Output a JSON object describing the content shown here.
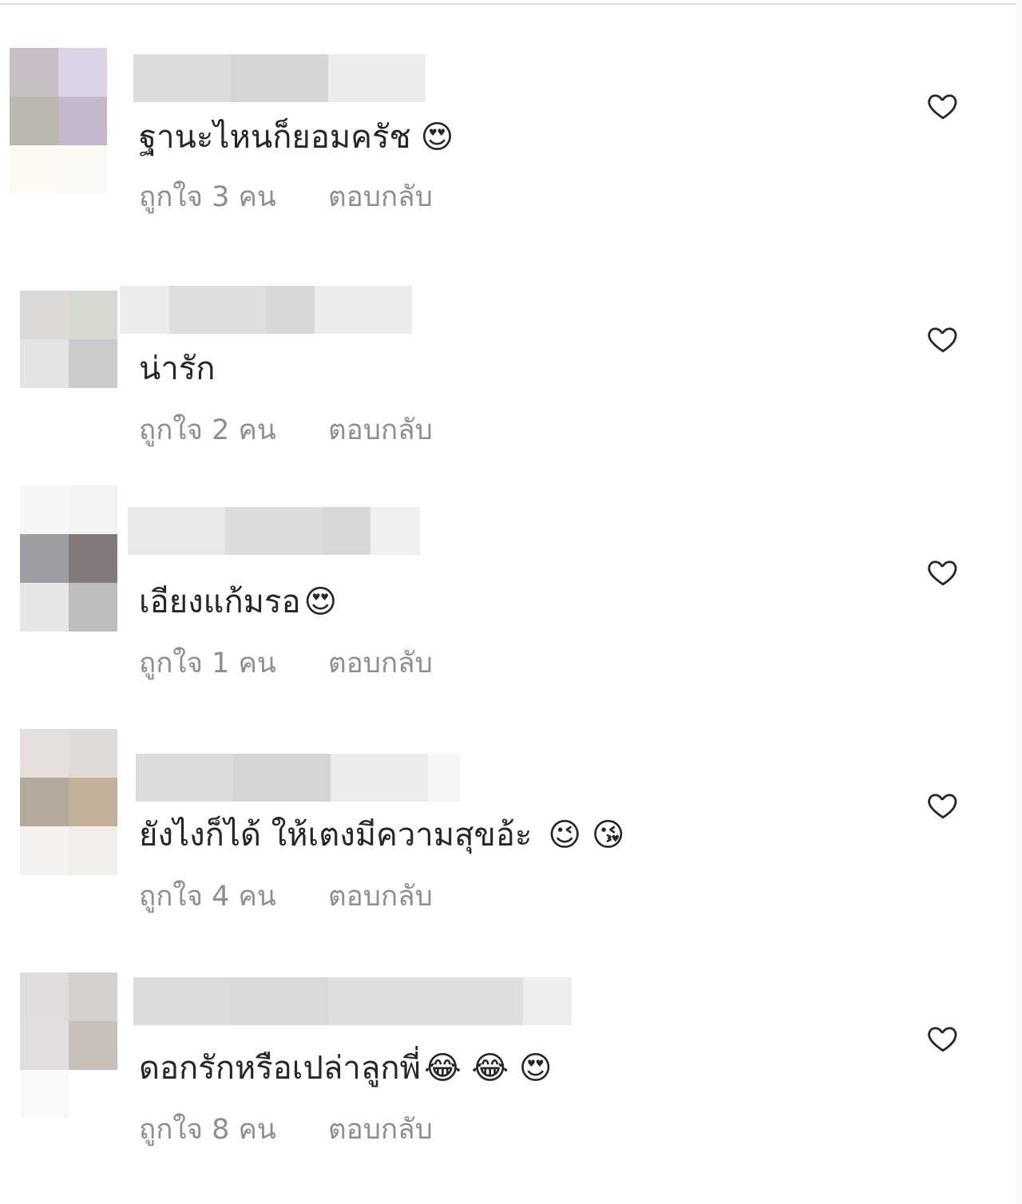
{
  "comments": [
    {
      "text": "ฐานะไหนก็ยอมครัช",
      "emoji": "😍",
      "likes": "ถูกใจ 3 คน",
      "reply": "ตอบกลับ",
      "avatar_colors": [
        "#c8bfc6",
        "#dcd3e6",
        "#bab8ae",
        "#c5b8cc",
        "#fdfaf3",
        "#fbf9f5"
      ],
      "name_colors": [
        "#dcdcdc",
        "#d6d6d6",
        "#ececec"
      ]
    },
    {
      "text": "น่ารัก",
      "emoji": "",
      "likes": "ถูกใจ 2 คน",
      "reply": "ตอบกลับ",
      "avatar_colors": [
        "#dcd9d6",
        "#d5d9d0",
        "#e4e4e4",
        "#cbcacc",
        "#ffffff",
        "#ffffff"
      ],
      "name_colors": [
        "#ececec",
        "#dedede",
        "#d7d7d7",
        "#ececec"
      ]
    },
    {
      "text": "เอียงแก้มรอ",
      "emoji": "😍",
      "likes": "ถูกใจ 1 คน",
      "reply": "ตอบกลับ",
      "avatar_colors": [
        "#f6f6f6",
        "#f3f3f3",
        "#9e9da4",
        "#827a7b",
        "#e6e6e6",
        "#bfbcbd"
      ],
      "name_colors": [
        "#e9e9e9",
        "#dcdcdc",
        "#d8d8d8",
        "#efefef"
      ]
    },
    {
      "text": "ยังไงก็ได้ ให้เตงมีความสุขอ้ะ",
      "emoji": "😉 😘",
      "likes": "ถูกใจ 4 คน",
      "reply": "ตอบกลับ",
      "avatar_colors": [
        "#e5e0dd",
        "#dedad6",
        "#b4a99c",
        "#c2b29a",
        "#f4f1ee",
        "#f2efea"
      ],
      "name_colors": [
        "#dcdcdc",
        "#d5d5d5",
        "#ececec",
        "#f6f6f6"
      ]
    },
    {
      "text": "ดอกรักหรือเปล่าลูกพี่",
      "emoji": "😂 😂 😍",
      "likes": "ถูกใจ 8 คน",
      "reply": "ตอบกลับ",
      "avatar_colors": [
        "#e0dcdb",
        "#d6d0cf",
        "#e1dde0",
        "#c8bfb9",
        "#f9f9f9",
        "#ffffff"
      ],
      "name_colors": [
        "#dcdcdc",
        "#d9d9d9",
        "#dedede",
        "#ededed"
      ]
    }
  ]
}
